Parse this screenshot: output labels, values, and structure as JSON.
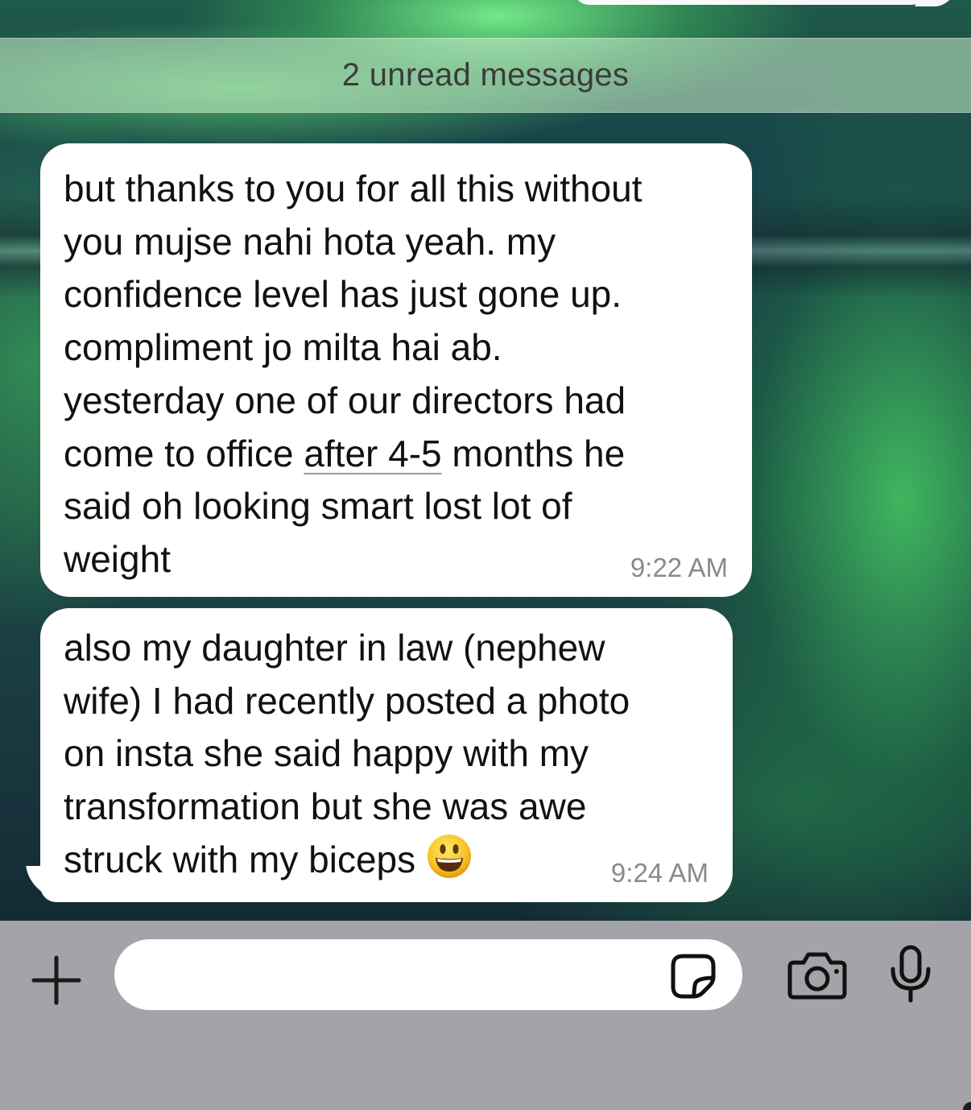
{
  "chat": {
    "unread_banner": "2 unread messages",
    "messages": [
      {
        "lines": [
          "but thanks to you for all this without",
          "you mujse nahi hota yeah. my",
          "confidence level has just gone up.",
          "compliment jo milta hai ab.",
          "yesterday one of our directors had",
          "said oh looking smart lost lot of",
          "weight"
        ],
        "line6_before": "come to office ",
        "line6_link": "after 4-5",
        "line6_after": " months he",
        "time": "9:22 AM"
      },
      {
        "lines": [
          "also my daughter in law (nephew",
          "wife) I had recently posted a photo",
          "on insta she said happy with my",
          "transformation but she was awe",
          "struck with my biceps"
        ],
        "emoji": "grinning-face-emoji",
        "time": "9:24 AM"
      }
    ]
  },
  "input_bar": {
    "message_value": "",
    "icons": {
      "plus": "plus-icon",
      "sticker": "sticker-icon",
      "camera": "camera-icon",
      "mic": "microphone-icon"
    }
  },
  "colors": {
    "bubble_bg": "#ffffff",
    "timestamp": "#8a8a8e",
    "input_bar_bg": "#a3a3a8",
    "banner_text": "#3b3b3b"
  }
}
